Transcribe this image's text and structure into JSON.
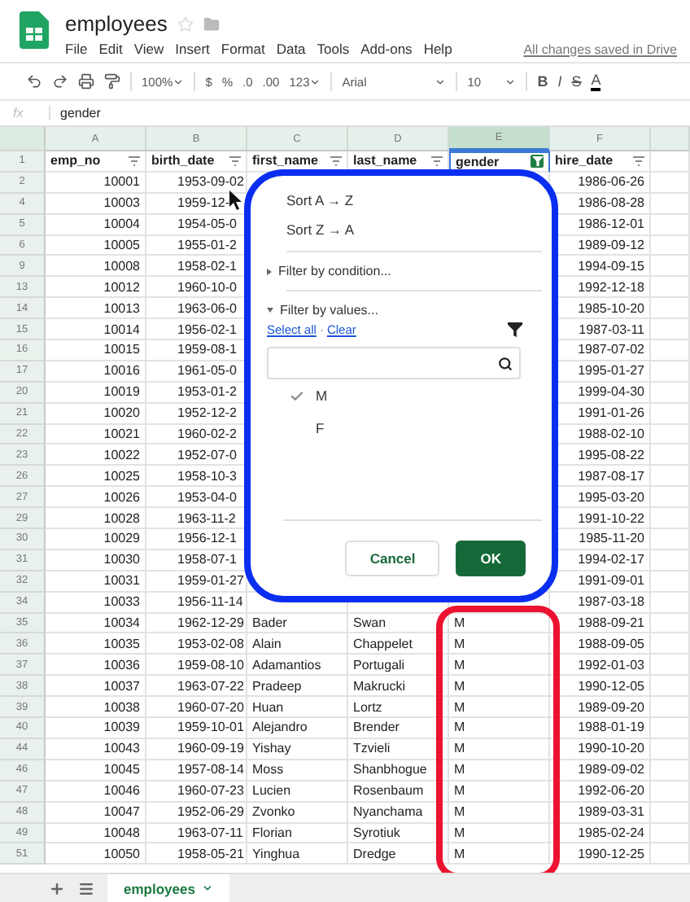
{
  "document": {
    "title": "employees",
    "save_status": "All changes saved in Drive"
  },
  "menu": [
    "File",
    "Edit",
    "View",
    "Insert",
    "Format",
    "Data",
    "Tools",
    "Add-ons",
    "Help"
  ],
  "toolbar": {
    "zoom": "100%",
    "currency": "$",
    "percent": "%",
    "decrease_decimals": ".0",
    "increase_decimals": ".00",
    "more_formats": "123",
    "font": "Arial",
    "font_size": "10",
    "bold": "B",
    "italic": "I",
    "strike": "S",
    "text_color": "A"
  },
  "formula_bar": {
    "label": "fx",
    "value": "gender"
  },
  "columns": [
    {
      "letter": "A",
      "selected": false
    },
    {
      "letter": "B",
      "selected": false
    },
    {
      "letter": "C",
      "selected": false
    },
    {
      "letter": "D",
      "selected": false
    },
    {
      "letter": "E",
      "selected": true
    },
    {
      "letter": "F",
      "selected": false
    }
  ],
  "header_row": {
    "number": "1",
    "cells": [
      {
        "text": "emp_no",
        "filtered": false
      },
      {
        "text": "birth_date",
        "filtered": false
      },
      {
        "text": "first_name",
        "filtered": false
      },
      {
        "text": "last_name",
        "filtered": false
      },
      {
        "text": "gender",
        "filtered": true
      },
      {
        "text": "hire_date",
        "filtered": false
      }
    ]
  },
  "rows": [
    {
      "number": "2",
      "emp_no": "10001",
      "birth_date": "1953-09-02",
      "hire_date": "1986-06-26"
    },
    {
      "number": "4",
      "emp_no": "10003",
      "birth_date": "1959-12-",
      "hire_date": "1986-08-28"
    },
    {
      "number": "5",
      "emp_no": "10004",
      "birth_date": "1954-05-0",
      "hire_date": "1986-12-01"
    },
    {
      "number": "6",
      "emp_no": "10005",
      "birth_date": "1955-01-2",
      "hire_date": "1989-09-12"
    },
    {
      "number": "9",
      "emp_no": "10008",
      "birth_date": "1958-02-1",
      "hire_date": "1994-09-15"
    },
    {
      "number": "13",
      "emp_no": "10012",
      "birth_date": "1960-10-0",
      "hire_date": "1992-12-18"
    },
    {
      "number": "14",
      "emp_no": "10013",
      "birth_date": "1963-06-0",
      "hire_date": "1985-10-20"
    },
    {
      "number": "15",
      "emp_no": "10014",
      "birth_date": "1956-02-1",
      "hire_date": "1987-03-11"
    },
    {
      "number": "16",
      "emp_no": "10015",
      "birth_date": "1959-08-1",
      "hire_date": "1987-07-02"
    },
    {
      "number": "17",
      "emp_no": "10016",
      "birth_date": "1961-05-0",
      "hire_date": "1995-01-27"
    },
    {
      "number": "20",
      "emp_no": "10019",
      "birth_date": "1953-01-2",
      "hire_date": "1999-04-30"
    },
    {
      "number": "21",
      "emp_no": "10020",
      "birth_date": "1952-12-2",
      "hire_date": "1991-01-26"
    },
    {
      "number": "22",
      "emp_no": "10021",
      "birth_date": "1960-02-2",
      "hire_date": "1988-02-10"
    },
    {
      "number": "23",
      "emp_no": "10022",
      "birth_date": "1952-07-0",
      "hire_date": "1995-08-22"
    },
    {
      "number": "26",
      "emp_no": "10025",
      "birth_date": "1958-10-3",
      "hire_date": "1987-08-17"
    },
    {
      "number": "27",
      "emp_no": "10026",
      "birth_date": "1953-04-0",
      "hire_date": "1995-03-20"
    },
    {
      "number": "29",
      "emp_no": "10028",
      "birth_date": "1963-11-2",
      "hire_date": "1991-10-22"
    },
    {
      "number": "30",
      "emp_no": "10029",
      "birth_date": "1956-12-1",
      "hire_date": "1985-11-20"
    },
    {
      "number": "31",
      "emp_no": "10030",
      "birth_date": "1958-07-1",
      "hire_date": "1994-02-17"
    },
    {
      "number": "32",
      "emp_no": "10031",
      "birth_date": "1959-01-27",
      "hire_date": "1991-09-01"
    },
    {
      "number": "34",
      "emp_no": "10033",
      "birth_date": "1956-11-14",
      "hire_date": "1987-03-18"
    },
    {
      "number": "35",
      "emp_no": "10034",
      "birth_date": "1962-12-29",
      "first_name": "Bader",
      "last_name": "Swan",
      "gender": "M",
      "hire_date": "1988-09-21"
    },
    {
      "number": "36",
      "emp_no": "10035",
      "birth_date": "1953-02-08",
      "first_name": "Alain",
      "last_name": "Chappelet",
      "gender": "M",
      "hire_date": "1988-09-05"
    },
    {
      "number": "37",
      "emp_no": "10036",
      "birth_date": "1959-08-10",
      "first_name": "Adamantios",
      "last_name": "Portugali",
      "gender": "M",
      "hire_date": "1992-01-03"
    },
    {
      "number": "38",
      "emp_no": "10037",
      "birth_date": "1963-07-22",
      "first_name": "Pradeep",
      "last_name": "Makrucki",
      "gender": "M",
      "hire_date": "1990-12-05"
    },
    {
      "number": "39",
      "emp_no": "10038",
      "birth_date": "1960-07-20",
      "first_name": "Huan",
      "last_name": "Lortz",
      "gender": "M",
      "hire_date": "1989-09-20"
    },
    {
      "number": "40",
      "emp_no": "10039",
      "birth_date": "1959-10-01",
      "first_name": "Alejandro",
      "last_name": "Brender",
      "gender": "M",
      "hire_date": "1988-01-19"
    },
    {
      "number": "44",
      "emp_no": "10043",
      "birth_date": "1960-09-19",
      "first_name": "Yishay",
      "last_name": "Tzvieli",
      "gender": "M",
      "hire_date": "1990-10-20"
    },
    {
      "number": "46",
      "emp_no": "10045",
      "birth_date": "1957-08-14",
      "first_name": "Moss",
      "last_name": "Shanbhogue",
      "gender": "M",
      "hire_date": "1989-09-02"
    },
    {
      "number": "47",
      "emp_no": "10046",
      "birth_date": "1960-07-23",
      "first_name": "Lucien",
      "last_name": "Rosenbaum",
      "gender": "M",
      "hire_date": "1992-06-20"
    },
    {
      "number": "48",
      "emp_no": "10047",
      "birth_date": "1952-06-29",
      "first_name": "Zvonko",
      "last_name": "Nyanchama",
      "gender": "M",
      "hire_date": "1989-03-31"
    },
    {
      "number": "49",
      "emp_no": "10048",
      "birth_date": "1963-07-11",
      "first_name": "Florian",
      "last_name": "Syrotiuk",
      "gender": "M",
      "hire_date": "1985-02-24"
    },
    {
      "number": "51",
      "emp_no": "10050",
      "birth_date": "1958-05-21",
      "first_name": "Yinghua",
      "last_name": "Dredge",
      "gender": "M",
      "hire_date": "1990-12-25"
    }
  ],
  "filter_menu": {
    "sort_items": [
      "Sort A → Z",
      "Sort Z → A"
    ],
    "sections": [
      {
        "label": "Filter by condition...",
        "expanded": false
      },
      {
        "label": "Filter by values...",
        "expanded": true
      }
    ],
    "select_all": "Select all",
    "separator": "·",
    "clear": "Clear",
    "values": [
      {
        "label": "M",
        "checked": true
      },
      {
        "label": "F",
        "checked": false
      }
    ],
    "cancel": "Cancel",
    "ok": "OK"
  },
  "annotations": [
    {
      "kind": "menu_outline",
      "color": "#0a2ef0"
    },
    {
      "kind": "column_outline",
      "color": "#ec1230"
    }
  ],
  "sheet_tabs": [
    {
      "label": "employees",
      "selected": true
    }
  ]
}
